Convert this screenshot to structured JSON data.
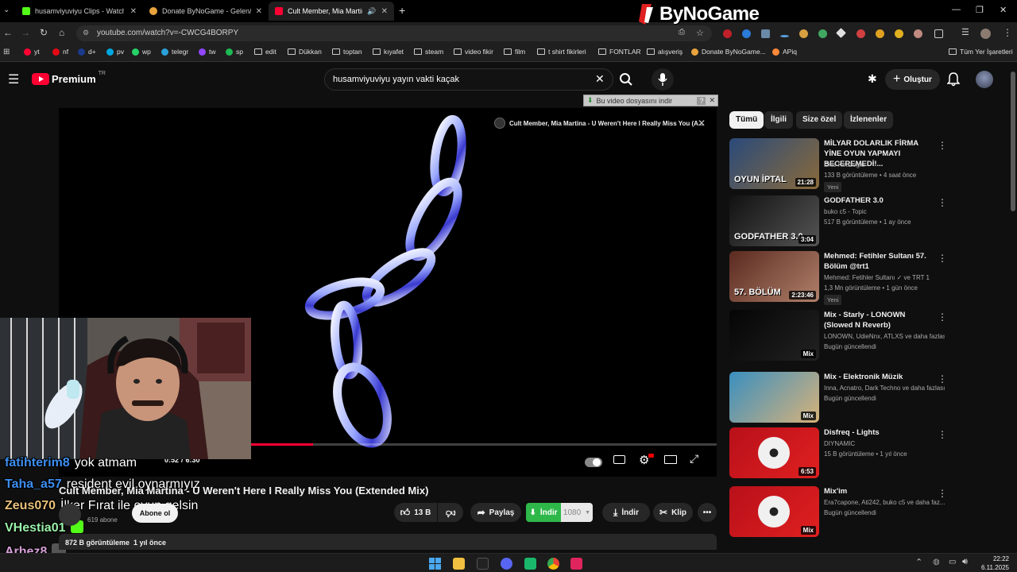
{
  "browser": {
    "tabs": [
      {
        "label": "husamviyuviyu Clips - Watch Li",
        "favicon_color": "#53fc18"
      },
      {
        "label": "Donate ByNoGame - Gelen/Gid",
        "favicon_color": "#e8a33d"
      },
      {
        "label": "Cult Member, Mia Martina",
        "favicon_color": "#ff0033"
      }
    ],
    "new_tab_label": "+",
    "url": "youtube.com/watch?v=-CWCG4BORPY",
    "bookmarks": [
      {
        "label": "yt",
        "kind": "yt-icon"
      },
      {
        "label": "nf",
        "kind": "netflix-icon"
      },
      {
        "label": "d+",
        "kind": "disney-icon"
      },
      {
        "label": "pv",
        "kind": "prime-icon"
      },
      {
        "label": "wp",
        "kind": "whatsapp-icon"
      },
      {
        "label": "telegr",
        "kind": "telegram-icon"
      },
      {
        "label": "tw",
        "kind": "twitch-icon"
      },
      {
        "label": "sp",
        "kind": "spotify-icon"
      },
      {
        "label": "edit",
        "kind": "folder-icon"
      },
      {
        "label": "Dükkan",
        "kind": "folder-icon"
      },
      {
        "label": "toptan",
        "kind": "folder-icon"
      },
      {
        "label": "kıyafet",
        "kind": "folder-icon"
      },
      {
        "label": "steam",
        "kind": "folder-icon"
      },
      {
        "label": "video fikir",
        "kind": "folder-icon"
      },
      {
        "label": "film",
        "kind": "folder-icon"
      },
      {
        "label": "t shirt fikirleri",
        "kind": "folder-icon"
      },
      {
        "label": "FONTLAR",
        "kind": "folder-icon"
      },
      {
        "label": "alışveriş",
        "kind": "folder-icon"
      },
      {
        "label": "Donate ByNoGame...",
        "kind": "bynogame-icon"
      },
      {
        "label": "APiq",
        "kind": "apiq-icon"
      }
    ],
    "all_bookmarks_label": "Tüm Yer İşaretleri"
  },
  "overlay_logo": "ByNoGame",
  "youtube": {
    "logo_text": "Premium",
    "logo_region": "TR",
    "search_value": "husamviyuviyu yayın vakti kaçak",
    "create_label": "Oluştur",
    "download_banner": "Bu video dosyasını indir",
    "player": {
      "overlay_title": "Cult Member, Mia Martina - U Weren't Here I Really Miss You (A...",
      "time_current": "0:52",
      "time_separator": "/",
      "time_total": "6:30",
      "progress_fraction": 0.133
    },
    "video_title": "Cult Member, Mia Martina - U Weren't Here I Really Miss You (Extended Mix)",
    "channel_subs": "619 abone",
    "subscribe_label": "Abone ol",
    "likes": "13 B",
    "share_label": "Paylaş",
    "download_green_label": "İndir",
    "quality_label": "1080",
    "download_label": "İndir",
    "clip_label": "Klip",
    "views_line": "872 B görüntüleme  1 yıl önce",
    "chips": [
      "Tümü",
      "İlgili",
      "Size özel",
      "İzlenenler"
    ],
    "recommendations": [
      {
        "title": "MİLYAR DOLARLIK FİRMA YİNE OYUN YAPMAYI BECEREMEDİ!...",
        "channel": "Enis Kirazoglu",
        "verified": true,
        "meta": "133 B görüntüleme • 4 saat önce",
        "badge": "Yeni",
        "duration": "21:28",
        "thumb_text": "OYUN İPTAL",
        "thumb_colors": [
          "#2a4a7a",
          "#8a6a3a"
        ]
      },
      {
        "title": "GODFATHER 3.0",
        "channel": "buko c5 - Topic",
        "verified": false,
        "meta": "517 B görüntüleme • 1 ay önce",
        "badge": "",
        "duration": "3:04",
        "thumb_text": "GODFATHER 3.0",
        "thumb_colors": [
          "#111111",
          "#555555"
        ]
      },
      {
        "title": "Mehmed: Fetihler Sultanı 57. Bölüm @trt1",
        "channel": "Mehmed: Fetihler Sultanı ✓ ve TRT 1",
        "verified": true,
        "meta": "1,3 Mn görüntüleme • 1 gün önce",
        "badge": "Yeni",
        "duration": "2:23:46",
        "thumb_text": "57. BÖLÜM",
        "thumb_colors": [
          "#5a2a20",
          "#b0806a"
        ]
      },
      {
        "title": "Mix - Starly - LONOWN (Slowed N Reverb)",
        "channel": "LONOWN, UdieNnx, ATLXS ve daha fazlası",
        "verified": false,
        "meta": "Bugün güncellendi",
        "badge": "",
        "duration": "Mix",
        "thumb_text": "",
        "thumb_colors": [
          "#050505",
          "#222222"
        ]
      },
      {
        "title": "Mix - Elektronik Müzik",
        "channel": "Inna, Acnatro, Dark Techno ve daha fazlası",
        "verified": false,
        "meta": "Bugün güncellendi",
        "badge": "",
        "duration": "Mix",
        "thumb_text": "",
        "thumb_colors": [
          "#3a8fbf",
          "#d7b27a"
        ]
      },
      {
        "title": "Disfreq - Lights",
        "channel": "DIYNAMIC",
        "verified": true,
        "meta": "15 B görüntüleme • 1 yıl önce",
        "badge": "",
        "duration": "6:53",
        "thumb_text": "",
        "thumb_colors": [
          "#b8101a",
          "#e02020"
        ]
      },
      {
        "title": "Mix'im",
        "channel": "Era7capone, Ati242, buko c5 ve daha faz...",
        "verified": false,
        "meta": "Bugün güncellendi",
        "badge": "",
        "duration": "Mix",
        "thumb_text": "",
        "thumb_colors": [
          "#b8101a",
          "#e02020"
        ]
      }
    ]
  },
  "chat": [
    {
      "user": "fatihterim8",
      "user_color": "#3d8ef0",
      "message": "yok atmam"
    },
    {
      "user": "Taha_a57",
      "user_color": "#3d8ef0",
      "message": "resident evil oynarmıyız"
    },
    {
      "user": "Zeus070",
      "user_color": "#e8c07a",
      "message": "İlker Fırat ile oyun gelsin"
    },
    {
      "user": "VHestia01",
      "user_color": "#9af0a8",
      "message": ""
    },
    {
      "user": "Arhez8",
      "user_color": "#d6a0d8",
      "message": ""
    }
  ],
  "taskbar": {
    "time": "22:22",
    "date": "6.11.2025"
  }
}
